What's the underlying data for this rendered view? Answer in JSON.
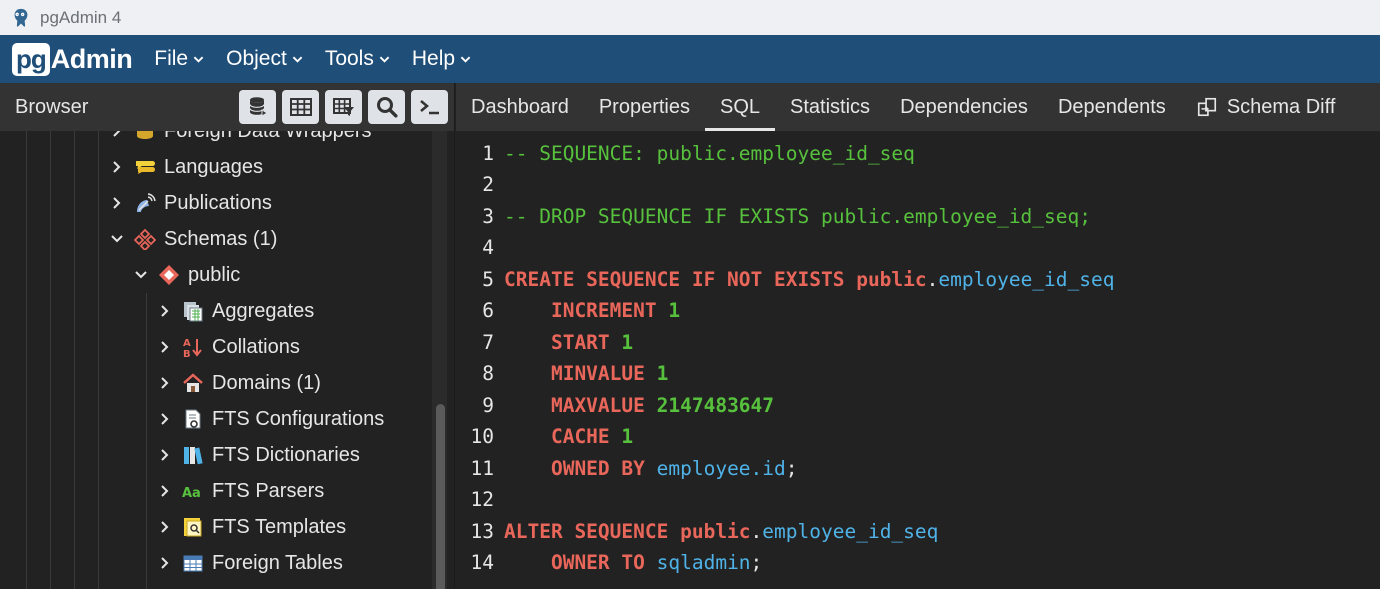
{
  "window": {
    "title": "pgAdmin 4"
  },
  "menubar": {
    "logo_pg": "pg",
    "logo_admin": "Admin",
    "items": [
      "File",
      "Object",
      "Tools",
      "Help"
    ]
  },
  "browser": {
    "label": "Browser",
    "toolbar_icons": [
      "database-icon",
      "table-grid-icon",
      "filtered-table-icon",
      "search-icon",
      "terminal-icon"
    ]
  },
  "tabs": {
    "items": [
      "Dashboard",
      "Properties",
      "SQL",
      "Statistics",
      "Dependencies",
      "Dependents",
      "Schema Diff"
    ],
    "active": "SQL"
  },
  "tree": {
    "items": [
      {
        "label": "Foreign Data Wrappers",
        "expanded": false,
        "icon": "foreign-data-wrapper-icon"
      },
      {
        "label": "Languages",
        "expanded": false,
        "icon": "language-icon"
      },
      {
        "label": "Publications",
        "expanded": false,
        "icon": "publication-icon"
      },
      {
        "label": "Schemas (1)",
        "expanded": true,
        "icon": "schemas-icon"
      },
      {
        "label": "public",
        "expanded": true,
        "icon": "schema-icon"
      },
      {
        "label": "Aggregates",
        "expanded": false,
        "icon": "aggregate-icon"
      },
      {
        "label": "Collations",
        "expanded": false,
        "icon": "collation-icon"
      },
      {
        "label": "Domains (1)",
        "expanded": false,
        "icon": "domain-icon"
      },
      {
        "label": "FTS Configurations",
        "expanded": false,
        "icon": "fts-configuration-icon"
      },
      {
        "label": "FTS Dictionaries",
        "expanded": false,
        "icon": "fts-dictionary-icon"
      },
      {
        "label": "FTS Parsers",
        "expanded": false,
        "icon": "fts-parser-icon"
      },
      {
        "label": "FTS Templates",
        "expanded": false,
        "icon": "fts-template-icon"
      },
      {
        "label": "Foreign Tables",
        "expanded": false,
        "icon": "foreign-table-icon"
      }
    ]
  },
  "sql": {
    "line_numbers": [
      "1",
      "2",
      "3",
      "4",
      "5",
      "6",
      "7",
      "8",
      "9",
      "10",
      "11",
      "12",
      "13",
      "14"
    ],
    "l1": "-- SEQUENCE: public.employee_id_seq",
    "l3": "-- DROP SEQUENCE IF EXISTS public.employee_id_seq;",
    "l5_kw": "CREATE SEQUENCE IF NOT EXISTS public",
    "l5_dot": ".",
    "l5_name": "employee_id_seq",
    "l6_kw": "    INCREMENT ",
    "l6_num": "1",
    "l7_kw": "    START ",
    "l7_num": "1",
    "l8_kw": "    MINVALUE ",
    "l8_num": "1",
    "l9_kw": "    MAXVALUE ",
    "l9_num": "2147483647",
    "l10_kw": "    CACHE ",
    "l10_num": "1",
    "l11_kw": "    OWNED BY ",
    "l11_ref": "employee.id",
    "l11_end": ";",
    "l13_kw": "ALTER SEQUENCE public",
    "l13_dot": ".",
    "l13_name": "employee_id_seq",
    "l14_kw": "    OWNER TO ",
    "l14_ref": "sqladmin",
    "l14_end": ";"
  },
  "colors": {
    "menubar": "#1f4e79",
    "keyword": "#e8665a",
    "comment": "#57c13d",
    "identifier": "#4fb3e8"
  }
}
